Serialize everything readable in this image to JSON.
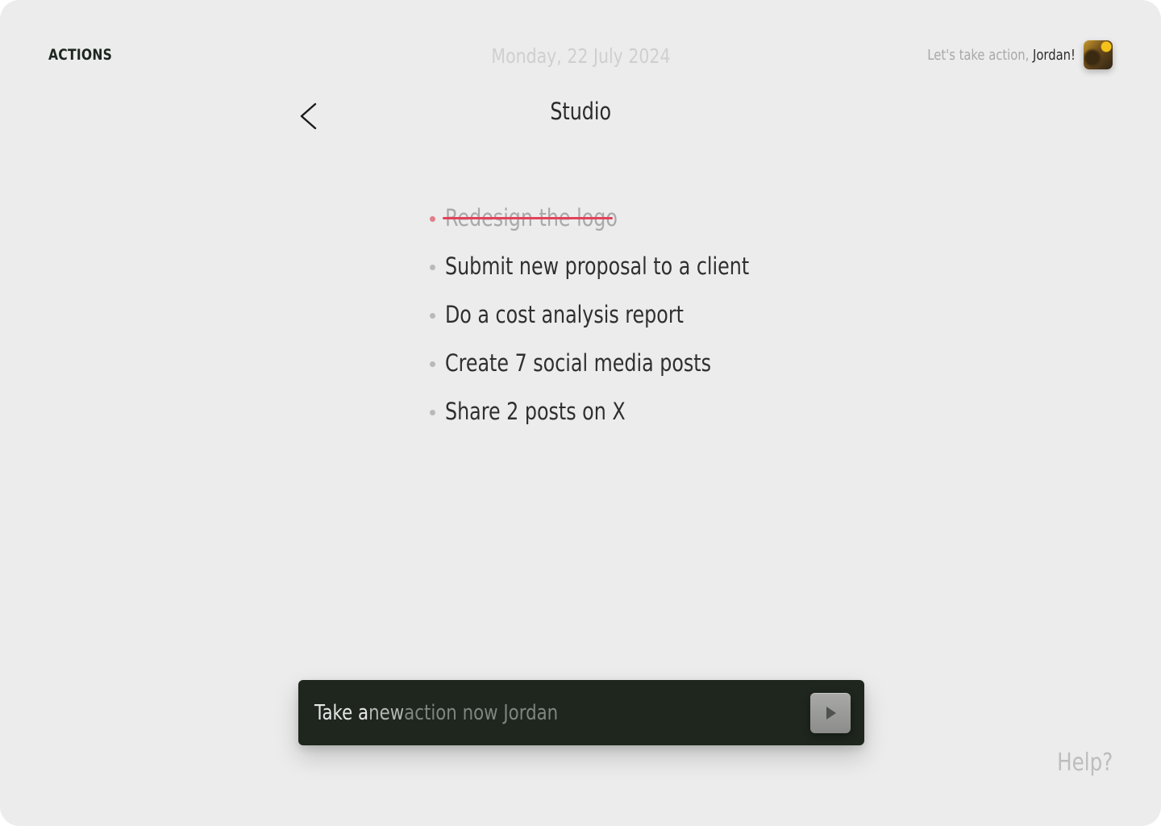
{
  "header": {
    "brand": "ACTIONS",
    "date": "Monday, 22 July 2024",
    "greeting_prefix": "Let's take action, ",
    "user_name": "Jordan!"
  },
  "list": {
    "title": "Studio",
    "tasks": [
      {
        "text": "Redesign the logo",
        "done": true
      },
      {
        "text": "Submit new proposal to a client",
        "done": false
      },
      {
        "text": "Do a cost analysis report",
        "done": false
      },
      {
        "text": "Create 7 social media posts",
        "done": false
      },
      {
        "text": "Share 2 posts on X",
        "done": false
      }
    ]
  },
  "composer": {
    "placeholder_part1": "Take a ",
    "placeholder_part2": "new ",
    "placeholder_part3": "action now Jordan",
    "send_icon": "play-icon"
  },
  "footer": {
    "help_label": "Help?"
  },
  "colors": {
    "background": "#ececec",
    "composer_bg": "#1e261e",
    "strike": "#e3425a"
  }
}
